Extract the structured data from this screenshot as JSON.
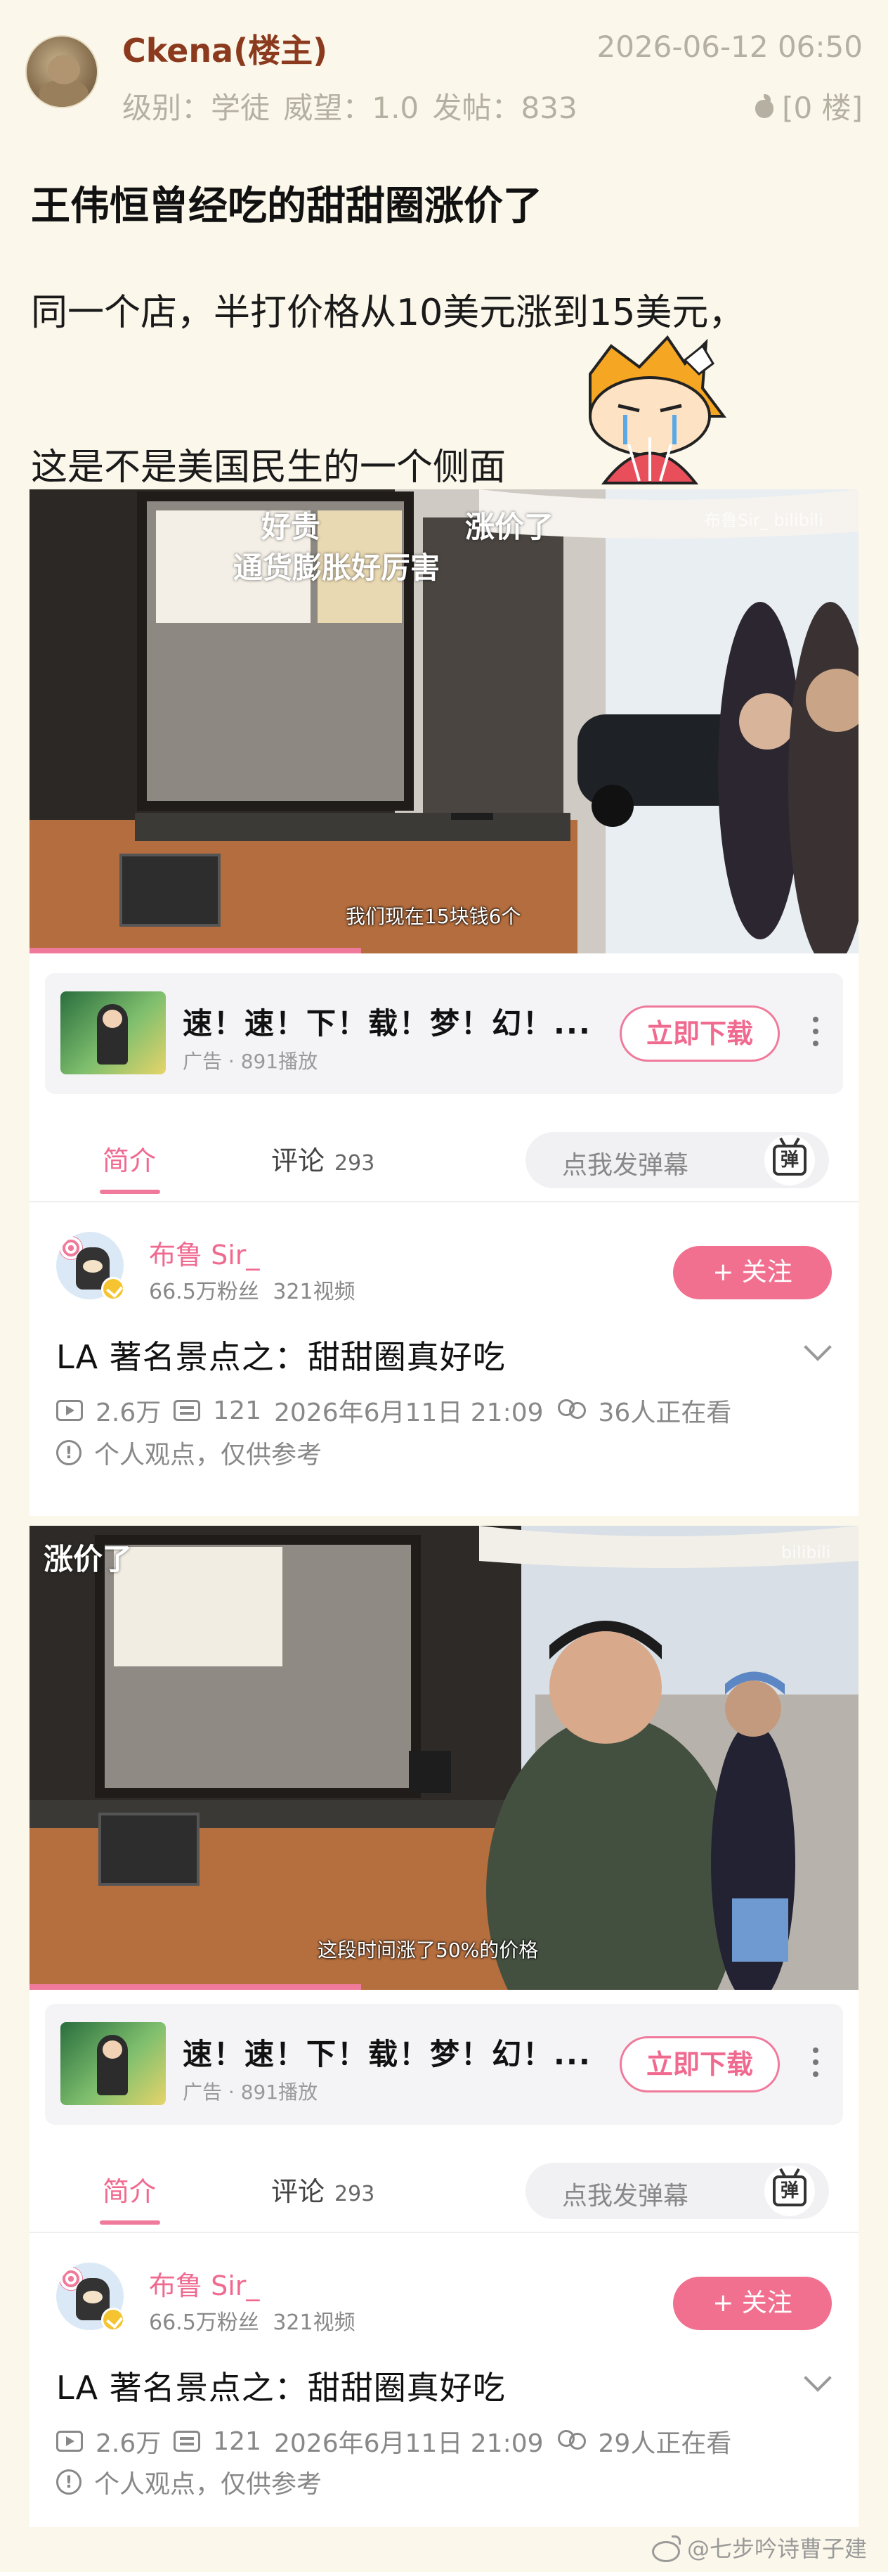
{
  "post": {
    "author": "Ckena(楼主)",
    "time": "2026-06-12 06:50",
    "meta": "级别：学徒  威望：1.0  发帖：833",
    "floor": "[0 楼]",
    "title": "王伟恒曾经吃的甜甜圈涨价了",
    "line1": "同一个店，半打价格从10美元涨到15美元，",
    "line2": "这是不是美国民生的一个侧面"
  },
  "shots": [
    {
      "overlay_left": "好贵",
      "overlay_mid": "通货膨胀好厉害",
      "overlay_right": "涨价了",
      "watermark": "布鲁Sir_ bilibili",
      "subtitle": "我们现在15块钱6个",
      "progress": 0.4,
      "ad_title": "速！速！下！载！梦！幻！...",
      "ad_sub": "广告 · 891播放",
      "ad_button": "立即下载",
      "tab_intro": "简介",
      "tab_comment": "评论",
      "comment_count": "293",
      "danmu_placeholder": "点我发弹幕",
      "danmu_icon_label": "弹",
      "up_name": "布鲁 Sir_",
      "up_stats": "66.5万粉丝  321视频",
      "follow": "+ 关注",
      "video_title": "LA 著名景点之：甜甜圈真好吃",
      "plays": "2.6万",
      "danmu_count": "121",
      "pub_date": "2026年6月11日 21:09",
      "watching": "36人正在看",
      "disclaimer": "个人观点，仅供参考"
    },
    {
      "overlay_left": "涨价了",
      "watermark": "bilibili",
      "subtitle": "这段时间涨了50%的价格",
      "progress": 0.4,
      "ad_title": "速！速！下！载！梦！幻！...",
      "ad_sub": "广告 · 891播放",
      "ad_button": "立即下载",
      "tab_intro": "简介",
      "tab_comment": "评论",
      "comment_count": "293",
      "danmu_placeholder": "点我发弹幕",
      "danmu_icon_label": "弹",
      "up_name": "布鲁 Sir_",
      "up_stats": "66.5万粉丝  321视频",
      "follow": "+ 关注",
      "video_title": "LA 著名景点之：甜甜圈真好吃",
      "plays": "2.6万",
      "danmu_count": "121",
      "pub_date": "2026年6月11日 21:09",
      "watching": "29人正在看",
      "disclaimer": "个人观点，仅供参考"
    }
  ],
  "footer_watermark": "@七步吟诗曹子建",
  "colors": {
    "accent": "#f07a9c",
    "author": "#8b3a1e",
    "meta": "#b5b0a2",
    "background": "#fbf7ea"
  }
}
